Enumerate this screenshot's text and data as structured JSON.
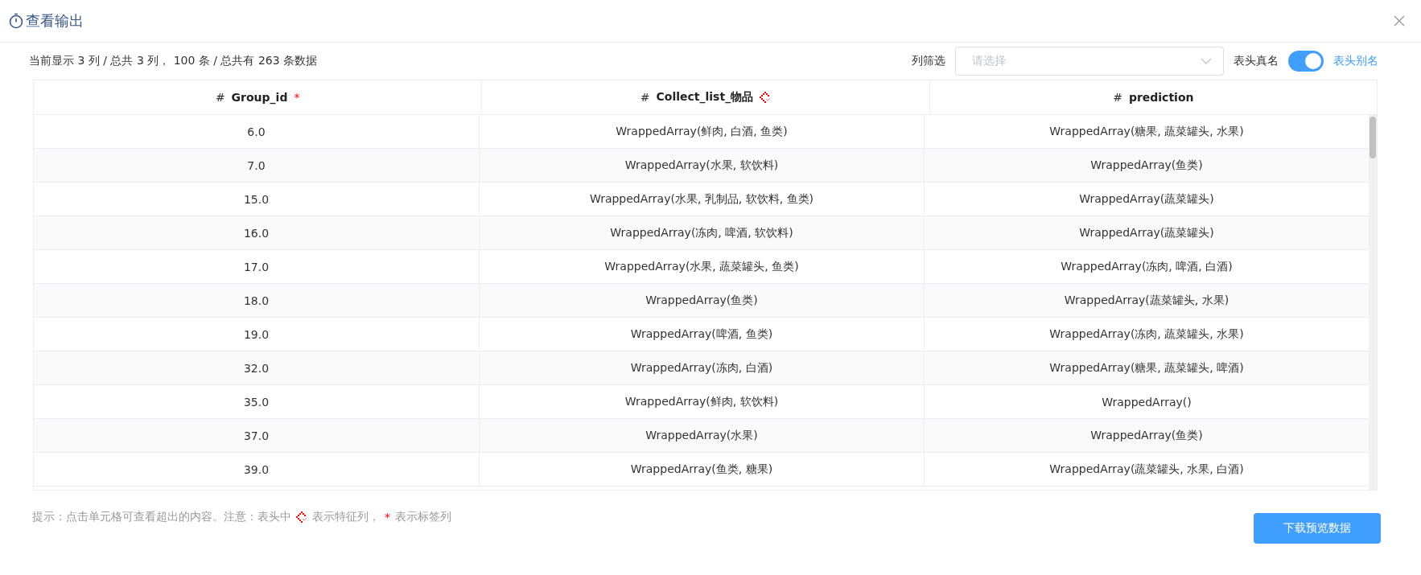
{
  "dialog": {
    "title": "查看输出"
  },
  "summary": "当前显示 3 列 / 总共 3 列， 100 条 / 总共有 263 条数据",
  "column_filter": {
    "label": "列筛选",
    "placeholder": "请选择"
  },
  "header_toggle": {
    "off_label": "表头真名",
    "on_label": "表头别名",
    "on": true
  },
  "table": {
    "columns": [
      {
        "type_mark": "#",
        "name": "Group_id",
        "kind": "label",
        "marker_text": "*"
      },
      {
        "type_mark": "#",
        "name": "Collect_list_物品",
        "kind": "feature"
      },
      {
        "type_mark": "#",
        "name": "prediction",
        "kind": "plain"
      }
    ],
    "rows": [
      [
        "6.0",
        "WrappedArray(鲜肉, 白酒, 鱼类)",
        "WrappedArray(糖果, 蔬菜罐头, 水果)"
      ],
      [
        "7.0",
        "WrappedArray(水果, 软饮料)",
        "WrappedArray(鱼类)"
      ],
      [
        "15.0",
        "WrappedArray(水果, 乳制品, 软饮料, 鱼类)",
        "WrappedArray(蔬菜罐头)"
      ],
      [
        "16.0",
        "WrappedArray(冻肉, 啤酒, 软饮料)",
        "WrappedArray(蔬菜罐头)"
      ],
      [
        "17.0",
        "WrappedArray(水果, 蔬菜罐头, 鱼类)",
        "WrappedArray(冻肉, 啤酒, 白酒)"
      ],
      [
        "18.0",
        "WrappedArray(鱼类)",
        "WrappedArray(蔬菜罐头, 水果)"
      ],
      [
        "19.0",
        "WrappedArray(啤酒, 鱼类)",
        "WrappedArray(冻肉, 蔬菜罐头, 水果)"
      ],
      [
        "32.0",
        "WrappedArray(冻肉, 白酒)",
        "WrappedArray(糖果, 蔬菜罐头, 啤酒)"
      ],
      [
        "35.0",
        "WrappedArray(鲜肉, 软饮料)",
        "WrappedArray()"
      ],
      [
        "37.0",
        "WrappedArray(水果)",
        "WrappedArray(鱼类)"
      ],
      [
        "39.0",
        "WrappedArray(鱼类, 糖果)",
        "WrappedArray(蔬菜罐头, 水果, 白酒)"
      ]
    ]
  },
  "hint": {
    "prefix": "提示：点击单元格可查看超出的内容。注意：表头中",
    "feature_text": "表示特征列，",
    "label_mark": "*",
    "label_text": "表示标签列"
  },
  "download_button": "下载预览数据"
}
